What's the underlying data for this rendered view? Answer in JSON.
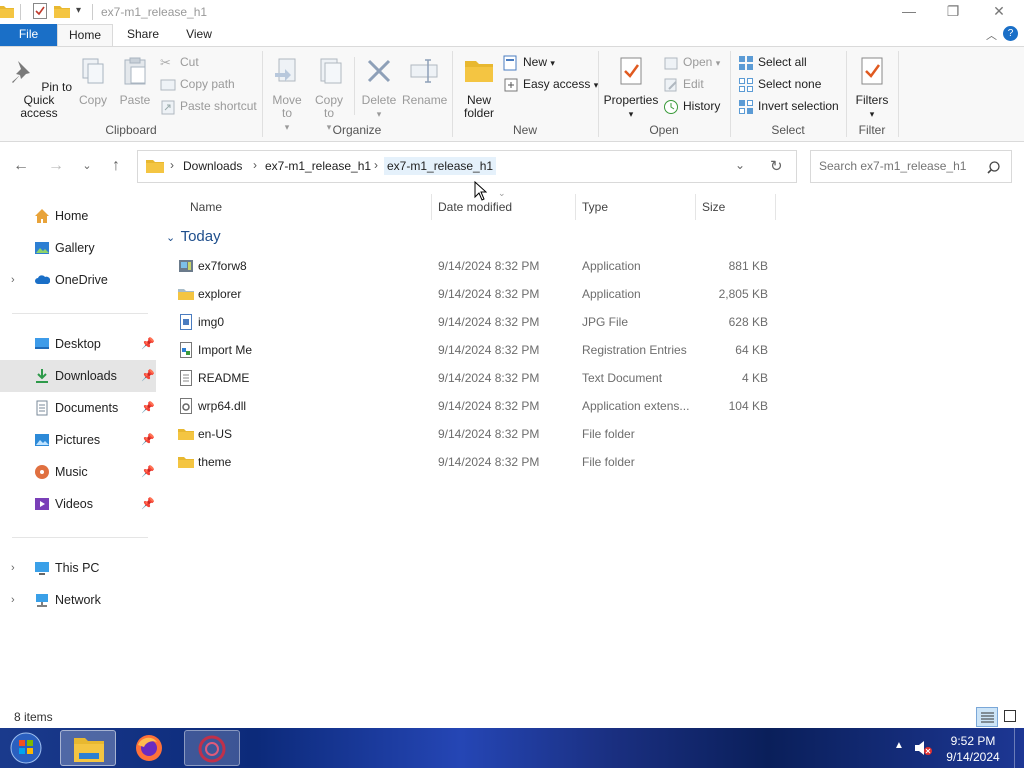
{
  "window": {
    "title": "ex7-m1_release_h1",
    "controls": {
      "minimize": "—",
      "maximize": "❐",
      "close": "✕"
    }
  },
  "ribbon_tabs": {
    "file": "File",
    "home": "Home",
    "share": "Share",
    "view": "View"
  },
  "ribbon": {
    "clipboard": {
      "label": "Clipboard",
      "pin": "Pin to Quick access",
      "copy": "Copy",
      "paste": "Paste",
      "cut": "Cut",
      "copy_path": "Copy path",
      "paste_shortcut": "Paste shortcut"
    },
    "organize": {
      "label": "Organize",
      "move_to": "Move to",
      "copy_to": "Copy to",
      "delete": "Delete",
      "rename": "Rename"
    },
    "new": {
      "label": "New",
      "new_folder": "New folder",
      "new_item": "New",
      "easy_access": "Easy access"
    },
    "open": {
      "label": "Open",
      "properties": "Properties",
      "open": "Open",
      "edit": "Edit",
      "history": "History"
    },
    "select": {
      "label": "Select",
      "select_all": "Select all",
      "select_none": "Select none",
      "invert_selection": "Invert selection"
    },
    "filter": {
      "label": "Filter",
      "filters": "Filters"
    }
  },
  "breadcrumb": [
    "Downloads",
    "ex7-m1_release_h1",
    "ex7-m1_release_h1"
  ],
  "search": {
    "placeholder": "Search ex7-m1_release_h1"
  },
  "nav_pane": {
    "home": "Home",
    "gallery": "Gallery",
    "onedrive": "OneDrive",
    "quick_access": [
      {
        "label": "Desktop",
        "icon": "desktop-icon"
      },
      {
        "label": "Downloads",
        "icon": "downloads-icon",
        "selected": true
      },
      {
        "label": "Documents",
        "icon": "documents-icon"
      },
      {
        "label": "Pictures",
        "icon": "pictures-icon"
      },
      {
        "label": "Music",
        "icon": "music-icon"
      },
      {
        "label": "Videos",
        "icon": "videos-icon"
      }
    ],
    "this_pc": "This PC",
    "network": "Network"
  },
  "columns": {
    "name": "Name",
    "date": "Date modified",
    "type": "Type",
    "size": "Size"
  },
  "group_header": "Today",
  "files": [
    {
      "name": "ex7forw8",
      "date": "9/14/2024 8:32 PM",
      "type": "Application",
      "size": "881 KB",
      "icon": "application-icon"
    },
    {
      "name": "explorer",
      "date": "9/14/2024 8:32 PM",
      "type": "Application",
      "size": "2,805 KB",
      "icon": "explorer-app-icon"
    },
    {
      "name": "img0",
      "date": "9/14/2024 8:32 PM",
      "type": "JPG File",
      "size": "628 KB",
      "icon": "image-file-icon"
    },
    {
      "name": "Import Me",
      "date": "9/14/2024 8:32 PM",
      "type": "Registration Entries",
      "size": "64 KB",
      "icon": "registry-file-icon"
    },
    {
      "name": "README",
      "date": "9/14/2024 8:32 PM",
      "type": "Text Document",
      "size": "4 KB",
      "icon": "text-file-icon"
    },
    {
      "name": "wrp64.dll",
      "date": "9/14/2024 8:32 PM",
      "type": "Application extens...",
      "size": "104 KB",
      "icon": "dll-file-icon"
    },
    {
      "name": "en-US",
      "date": "9/14/2024 8:32 PM",
      "type": "File folder",
      "size": "",
      "icon": "folder-icon"
    },
    {
      "name": "theme",
      "date": "9/14/2024 8:32 PM",
      "type": "File folder",
      "size": "",
      "icon": "folder-icon"
    }
  ],
  "status": {
    "item_count": "8 items"
  },
  "taskbar": {
    "time": "9:52 PM",
    "date": "9/14/2024"
  },
  "colors": {
    "accent": "#1a6fc7",
    "folder": "#f4c542",
    "selection": "#e5f1fb"
  }
}
